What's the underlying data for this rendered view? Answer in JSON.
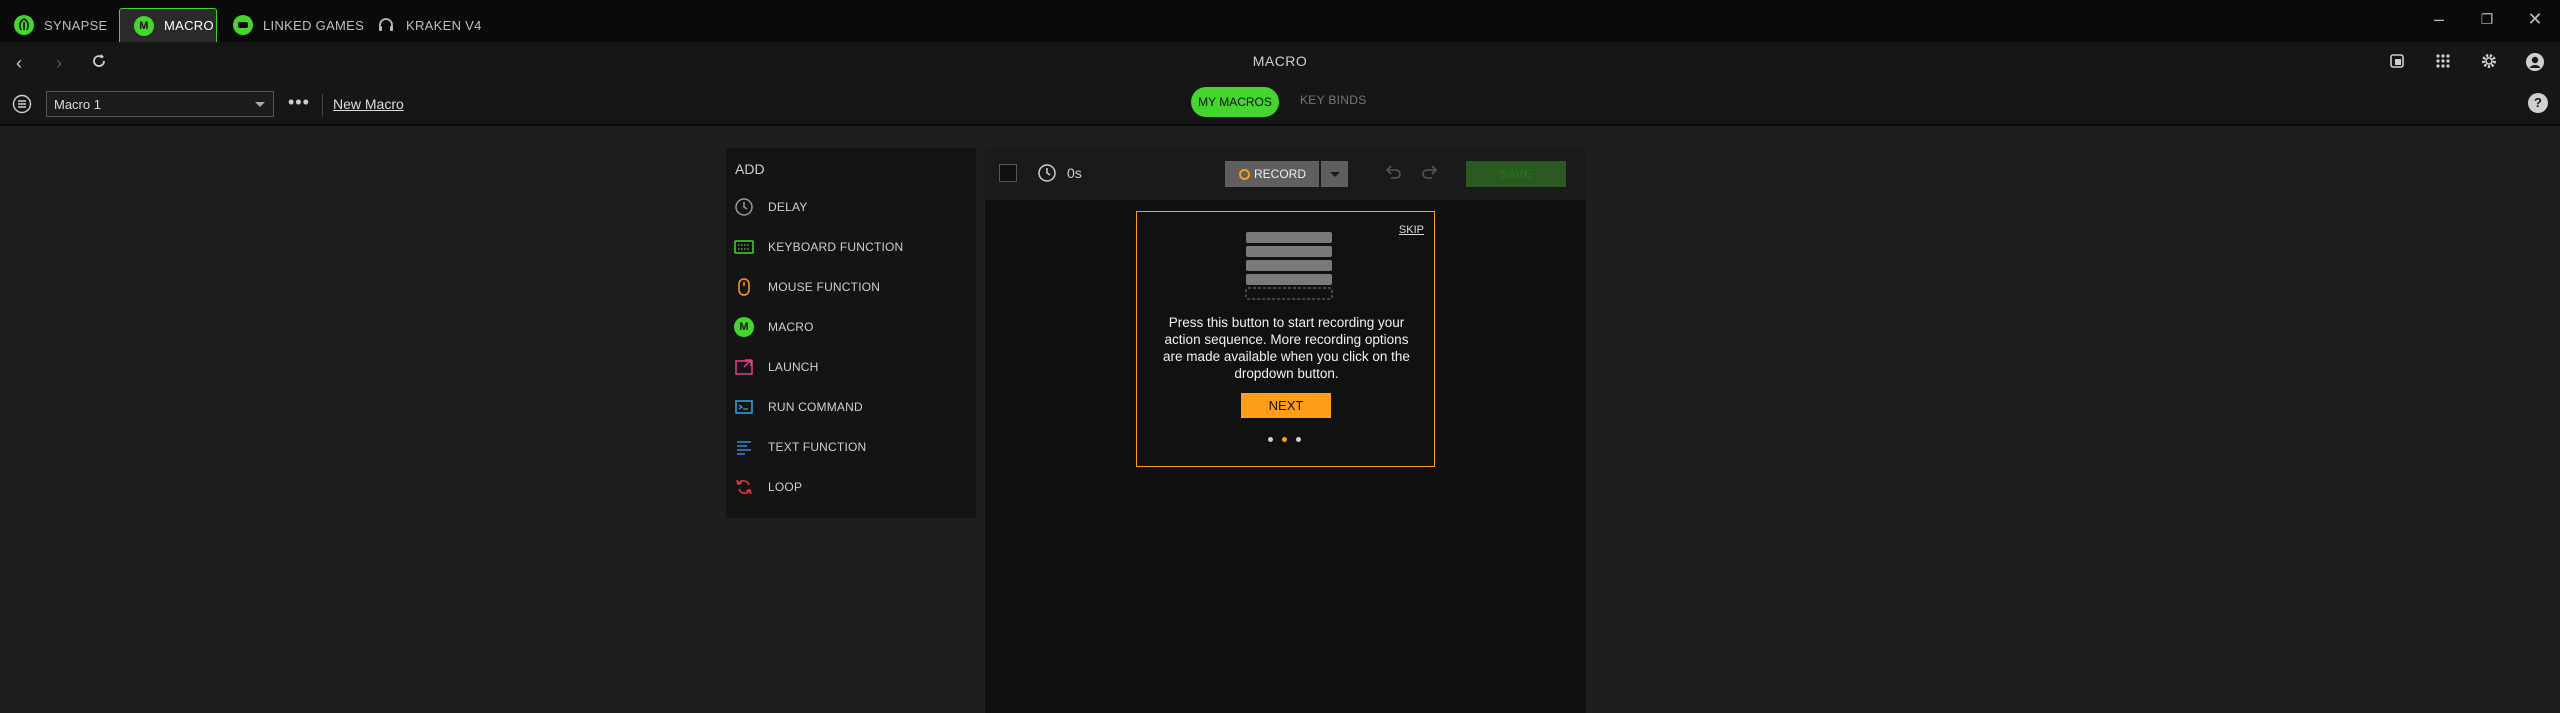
{
  "tabs": [
    {
      "label": "SYNAPSE",
      "icon": "razer-logo-icon",
      "active": false
    },
    {
      "label": "MACRO",
      "icon": "macro-icon",
      "active": true
    },
    {
      "label": "LINKED GAMES",
      "icon": "gamepad-icon",
      "active": false
    },
    {
      "label": "KRAKEN V4",
      "icon": "headset-icon",
      "active": false
    }
  ],
  "window_title": "MACRO",
  "macro_icon_letter": "M",
  "toolbar": {
    "selected_macro": "Macro 1",
    "more_label": "•••",
    "new_macro_label": "New Macro",
    "view_tabs": [
      "MY MACROS",
      "KEY BINDS"
    ],
    "help_label": "?"
  },
  "add_panel": {
    "title": "ADD",
    "items": [
      {
        "label": "DELAY",
        "icon": "clock-icon",
        "color": "#9a9a9a"
      },
      {
        "label": "KEYBOARD FUNCTION",
        "icon": "keyboard-icon",
        "color": "#44d62c"
      },
      {
        "label": "MOUSE FUNCTION",
        "icon": "mouse-icon",
        "color": "#ff9c1a"
      },
      {
        "label": "MACRO",
        "icon": "macro-icon",
        "color": "#44d62c"
      },
      {
        "label": "LAUNCH",
        "icon": "launch-icon",
        "color": "#e0408a"
      },
      {
        "label": "RUN COMMAND",
        "icon": "command-icon",
        "color": "#35a7e0"
      },
      {
        "label": "TEXT FUNCTION",
        "icon": "text-icon",
        "color": "#3a86d8"
      },
      {
        "label": "LOOP",
        "icon": "loop-icon",
        "color": "#e03a3a"
      }
    ]
  },
  "editor": {
    "duration": "0s",
    "record_label": "RECORD",
    "save_label": "SAVE"
  },
  "tooltip": {
    "skip_label": "SKIP",
    "text": "Press this button to start recording your action sequence. More recording options are made available when you click on the dropdown button.",
    "next_label": "NEXT",
    "step": 1,
    "steps_total": 3
  },
  "colors": {
    "accent": "#44d62c",
    "highlight": "#ff9c1a"
  }
}
